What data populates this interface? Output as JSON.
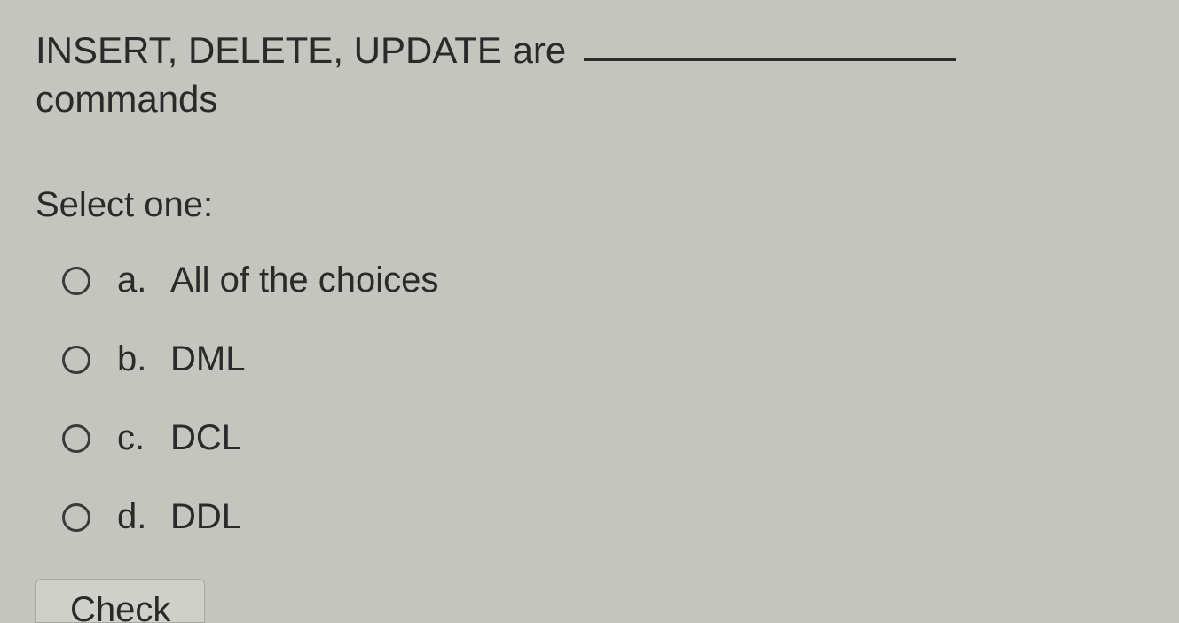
{
  "question": {
    "text_before": "INSERT, DELETE, UPDATE are ",
    "text_after": " commands"
  },
  "prompt": "Select one:",
  "options": [
    {
      "letter": "a.",
      "label": "All of the choices"
    },
    {
      "letter": "b.",
      "label": "DML"
    },
    {
      "letter": "c.",
      "label": "DCL"
    },
    {
      "letter": "d.",
      "label": "DDL"
    }
  ],
  "button": {
    "check_label": "Check"
  }
}
